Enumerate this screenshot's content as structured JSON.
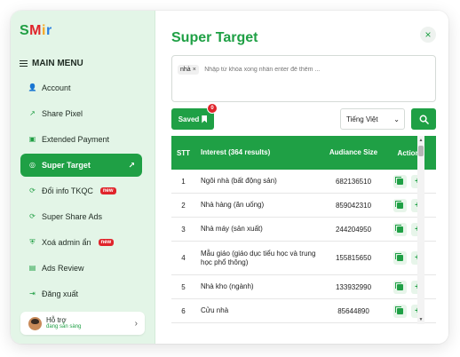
{
  "app": {
    "logo_letters": [
      "S",
      "M",
      "i",
      "r"
    ],
    "logo_colors": [
      "#1f9e43",
      "#e0242b",
      "#f5a623",
      "#2a7fe0"
    ]
  },
  "sidebar": {
    "menu_title": "MAIN MENU",
    "items": [
      {
        "label": "Account",
        "icon": "user-icon",
        "glyph": "👤"
      },
      {
        "label": "Share Pixel",
        "icon": "share-icon",
        "glyph": "↗"
      },
      {
        "label": "Extended Payment",
        "icon": "payment-icon",
        "glyph": "▣"
      },
      {
        "label": "Super Target",
        "icon": "target-icon",
        "glyph": "◎",
        "active": true
      },
      {
        "label": "Đổi info TKQC",
        "icon": "refresh-icon",
        "glyph": "⟳",
        "badge": "new"
      },
      {
        "label": "Super Share Ads",
        "icon": "refresh-icon",
        "glyph": "⟳"
      },
      {
        "label": "Xoá admin ẩn",
        "icon": "shield-icon",
        "glyph": "⛨",
        "badge": "new"
      },
      {
        "label": "Ads Review",
        "icon": "review-icon",
        "glyph": "▤"
      },
      {
        "label": "Đăng xuất",
        "icon": "logout-icon",
        "glyph": "⇥"
      }
    ],
    "support": {
      "title": "Hỗ trợ",
      "status": "đang sẵn sàng"
    }
  },
  "main": {
    "title": "Super Target",
    "search": {
      "tag": "nhà",
      "placeholder": "Nhập từ khóa xong nhấn enter để thêm ..."
    },
    "saved_label": "Saved",
    "saved_count": "0",
    "language": "Tiếng Việt",
    "table": {
      "headers": {
        "stt": "STT",
        "interest": "Interest (364 results)",
        "audience": "Audiance Size",
        "action": "Action"
      },
      "rows": [
        {
          "stt": "1",
          "interest": "Ngôi nhà (bất động sản)",
          "audience": "682136510"
        },
        {
          "stt": "2",
          "interest": "Nhà hàng (ăn uống)",
          "audience": "859042310"
        },
        {
          "stt": "3",
          "interest": "Nhà máy (sản xuất)",
          "audience": "244204950"
        },
        {
          "stt": "4",
          "interest": "Mẫu giáo (giáo dục tiểu học và trung học phổ thông)",
          "audience": "155815650",
          "tall": true
        },
        {
          "stt": "5",
          "interest": "Nhà kho (ngành)",
          "audience": "133932990"
        },
        {
          "stt": "6",
          "interest": "Cửu nhà",
          "audience": "85644890"
        }
      ]
    }
  }
}
